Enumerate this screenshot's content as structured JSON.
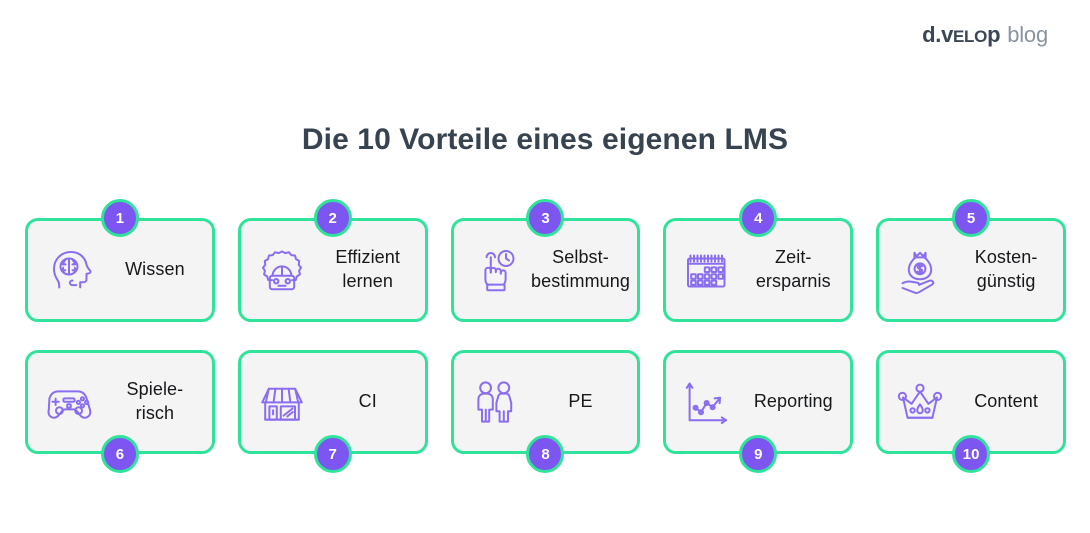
{
  "logo": {
    "mark_prefix": "d.v",
    "mark_smallcaps": "ELO",
    "mark_suffix": "p",
    "word": "blog"
  },
  "title": "Die 10 Vorteile eines eigenen LMS",
  "colors": {
    "card_border": "#2fe39b",
    "card_fill": "#f4f4f5",
    "badge_fill": "#7d55f0",
    "badge_ring": "#2fe39b",
    "icon_stroke": "#8b6df0",
    "title_text": "#37434f",
    "label_text": "#17181a",
    "background": "#ffffff"
  },
  "cards": [
    {
      "number": "1",
      "label": "Wissen",
      "icon": "brain-head-icon",
      "badge_position": "top"
    },
    {
      "number": "2",
      "label": "Effizient\nlernen",
      "icon": "robot-gear-icon",
      "badge_position": "top"
    },
    {
      "number": "3",
      "label": "Selbst-\nbestimmung",
      "icon": "hand-tap-clock-icon",
      "badge_position": "top"
    },
    {
      "number": "4",
      "label": "Zeit-\nersparnis",
      "icon": "calendar-icon",
      "badge_position": "top"
    },
    {
      "number": "5",
      "label": "Kosten-\ngünstig",
      "icon": "money-bag-hand-icon",
      "badge_position": "top"
    },
    {
      "number": "6",
      "label": "Spiele-\nrisch",
      "icon": "gamepad-icon",
      "badge_position": "bottom"
    },
    {
      "number": "7",
      "label": "CI",
      "icon": "storefront-icon",
      "badge_position": "bottom"
    },
    {
      "number": "8",
      "label": "PE",
      "icon": "two-people-icon",
      "badge_position": "bottom"
    },
    {
      "number": "9",
      "label": "Reporting",
      "icon": "line-chart-icon",
      "badge_position": "bottom"
    },
    {
      "number": "10",
      "label": "Content",
      "icon": "crown-icon",
      "badge_position": "bottom"
    }
  ]
}
